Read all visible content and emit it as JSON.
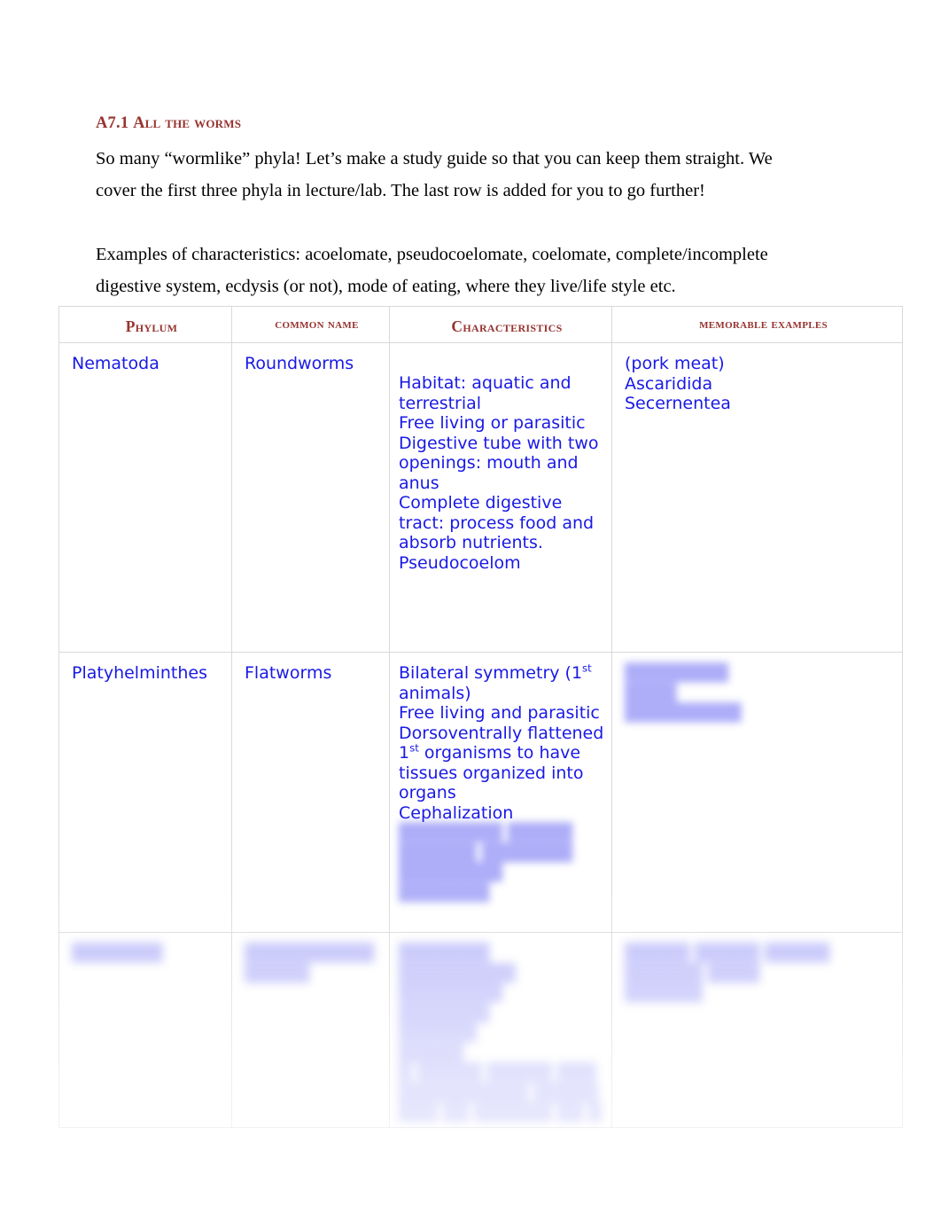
{
  "heading": {
    "number": "A7.1",
    "title": "All the worms"
  },
  "paragraphs": {
    "intro": "So  many “wormlike” phyla! Let’s make a study guide so that you can keep them straight. We cover the first three phyla in lecture/lab. The last row is added for you to go further!",
    "examples": "Examples of characteristics: acoelomate, pseudocoelomate, coelomate, complete/incomplete digestive system, ecdysis (or not), mode of eating, where they live/life style etc."
  },
  "table": {
    "headers": {
      "phylum": "Phylum",
      "common_name": "common name",
      "characteristics": "Characteristics",
      "memorable_examples": "memorable examples"
    },
    "rows": [
      {
        "phylum": "Nematoda",
        "common_name": "Roundworms",
        "characteristics_lines": [
          "Habitat: aquatic and terrestrial",
          "Free living or parasitic",
          "Digestive tube with two openings: mouth and anus",
          "Complete digestive tract: process food and absorb nutrients.",
          "Pseudocoelom"
        ],
        "examples_lines": [
          "(pork meat)",
          "Ascaridida",
          "Secernentea"
        ]
      },
      {
        "phylum": "Platyhelminthes",
        "common_name": "Flatworms",
        "characteristics_lines": [
          "Bilateral symmetry (1st animals)",
          "Free living and parasitic",
          "Dorsoventrally flattened",
          "1st organisms to have tissues organized into organs",
          "Cephalization"
        ],
        "characteristics_obscured_lines": [
          "████████ █████",
          "██████ ███████",
          "████████",
          "███████"
        ],
        "examples_obscured_lines": [
          "████████",
          "████",
          "█████████"
        ]
      },
      {
        "phylum_obscured": "███████",
        "common_name_obscured_lines": [
          "██████████",
          "█████"
        ],
        "characteristics_obscured_lines": [
          "███████ █████████",
          "████████",
          "███████",
          "██████",
          "█████",
          "█ █████ █████ ███",
          "██████████ █████",
          "███ ██ ██████ ██ █"
        ],
        "examples_obscured_lines": [
          "█████ █████ █████",
          "██████ ████",
          "██████"
        ]
      }
    ]
  },
  "colors": {
    "heading": "#96332f",
    "body_text": "#000000",
    "table_text": "#1919e6",
    "table_border": "#d9d9d9",
    "page_background": "#ffffff"
  }
}
